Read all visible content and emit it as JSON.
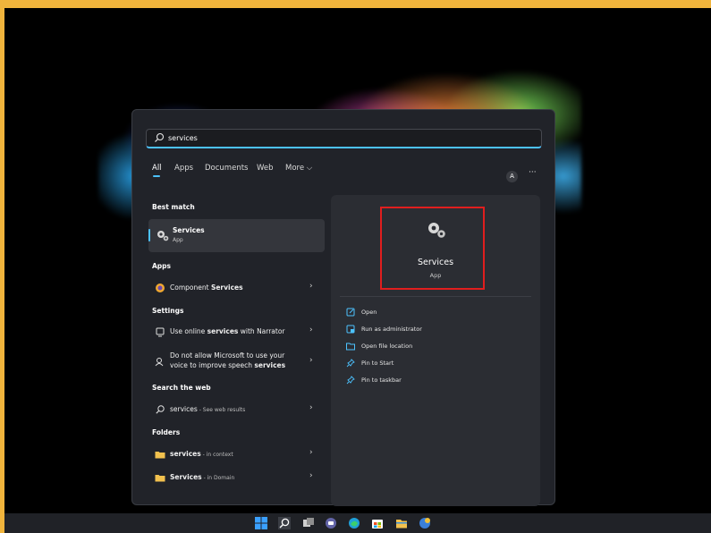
{
  "search": {
    "query": "services"
  },
  "filter_tabs": [
    "All",
    "Apps",
    "Documents",
    "Web",
    "More ⌵"
  ],
  "account": {
    "avatar_letter": "A",
    "more_label": "···"
  },
  "left": {
    "best_match_label": "Best match",
    "best_match": {
      "title": "Services",
      "subtitle": "App"
    },
    "apps_label": "Apps",
    "apps": [
      {
        "prefix": "Component ",
        "bold": "Services",
        "suffix": ""
      }
    ],
    "settings_label": "Settings",
    "settings": [
      {
        "prefix": "Use online ",
        "bold": "services",
        "suffix": " with Narrator"
      },
      {
        "line1": "Do not allow Microsoft to use your",
        "line2_prefix": "voice to improve speech ",
        "line2_bold": "services"
      }
    ],
    "web_label": "Search the web",
    "web": {
      "term": "services",
      "note": " - See web results"
    },
    "folders_label": "Folders",
    "folders": [
      {
        "name": "services",
        "note": " - in context"
      },
      {
        "name": "Services",
        "note": " - in Domain"
      }
    ],
    "chevron": "›"
  },
  "detail": {
    "title": "Services",
    "subtitle": "App",
    "actions": [
      "Open",
      "Run as administrator",
      "Open file location",
      "Pin to Start",
      "Pin to taskbar"
    ]
  },
  "colors": {
    "accent": "#4cc2ff",
    "highlight": "#e01e1e",
    "frame": "#f0b43c",
    "folder": "#f2c14e"
  },
  "icons": [
    "search-icon",
    "gear-icon",
    "component-services-icon",
    "narrator-icon",
    "speech-icon",
    "folder-icon",
    "open-icon",
    "admin-icon",
    "file-location-icon",
    "pin-icon",
    "windows-icon",
    "teams-icon",
    "edge-icon",
    "store-icon",
    "file-explorer-icon"
  ]
}
